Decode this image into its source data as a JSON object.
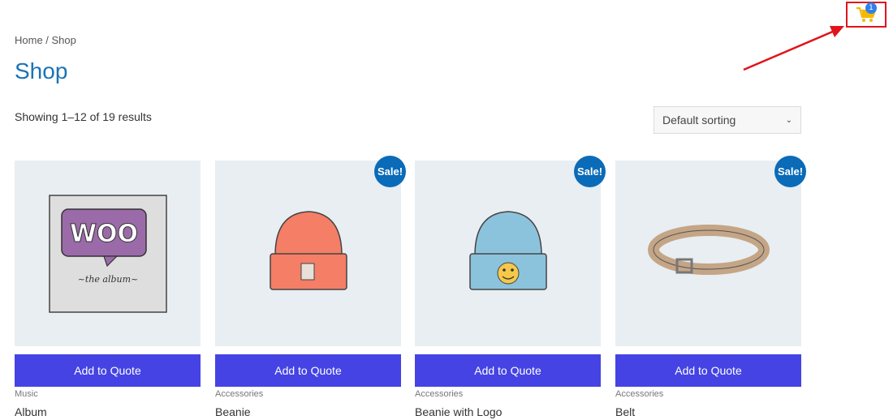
{
  "cart": {
    "count": "1",
    "icon": "cart-icon",
    "accent": "#f5b800"
  },
  "breadcrumb": "Home / Shop",
  "page_title": "Shop",
  "result_count": "Showing 1–12 of 19 results",
  "sorting": {
    "selected": "Default sorting"
  },
  "colors": {
    "button": "#4543e4",
    "sale": "#0a6bb8",
    "title": "#1a73b6",
    "highlight": "#e0141c"
  },
  "products": [
    {
      "name": "Album",
      "category": "Music",
      "button": "Add to Quote",
      "sale": ""
    },
    {
      "name": "Beanie",
      "category": "Accessories",
      "button": "Add to Quote",
      "sale": "Sale!"
    },
    {
      "name": "Beanie with Logo",
      "category": "Accessories",
      "button": "Add to Quote",
      "sale": "Sale!"
    },
    {
      "name": "Belt",
      "category": "Accessories",
      "button": "Add to Quote",
      "sale": "Sale!"
    }
  ],
  "album_art": {
    "logo": "WOO",
    "caption": "~the album~"
  }
}
